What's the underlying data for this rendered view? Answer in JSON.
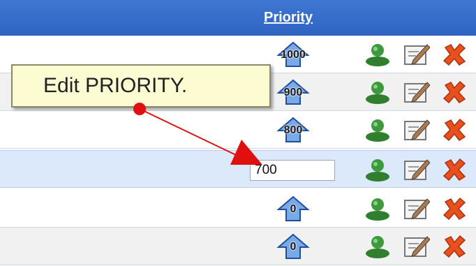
{
  "header": {
    "priority_label": "Priority"
  },
  "rows": [
    {
      "priority": "1000",
      "selected": false,
      "stripe": "odd"
    },
    {
      "priority": "900",
      "selected": false,
      "stripe": "even"
    },
    {
      "priority": "800",
      "selected": false,
      "stripe": "odd"
    },
    {
      "priority_input_value": "700",
      "selected": true,
      "stripe": "selected"
    },
    {
      "priority": "0",
      "selected": false,
      "stripe": "odd"
    },
    {
      "priority": "0",
      "selected": false,
      "stripe": "even"
    }
  ],
  "row_actions": [
    "user-icon",
    "edit-icon",
    "delete-icon"
  ],
  "annotation": {
    "text": "Edit PRIORITY."
  },
  "colors": {
    "header": "#3568c8",
    "selected_row": "#dbe9fb",
    "tooltip_bg": "#fdfbd2",
    "annotation_arrow": "#e01010",
    "delete": "#e8501c",
    "user": "#3c9a3c",
    "priority_arrow": "#7aa9e8"
  }
}
